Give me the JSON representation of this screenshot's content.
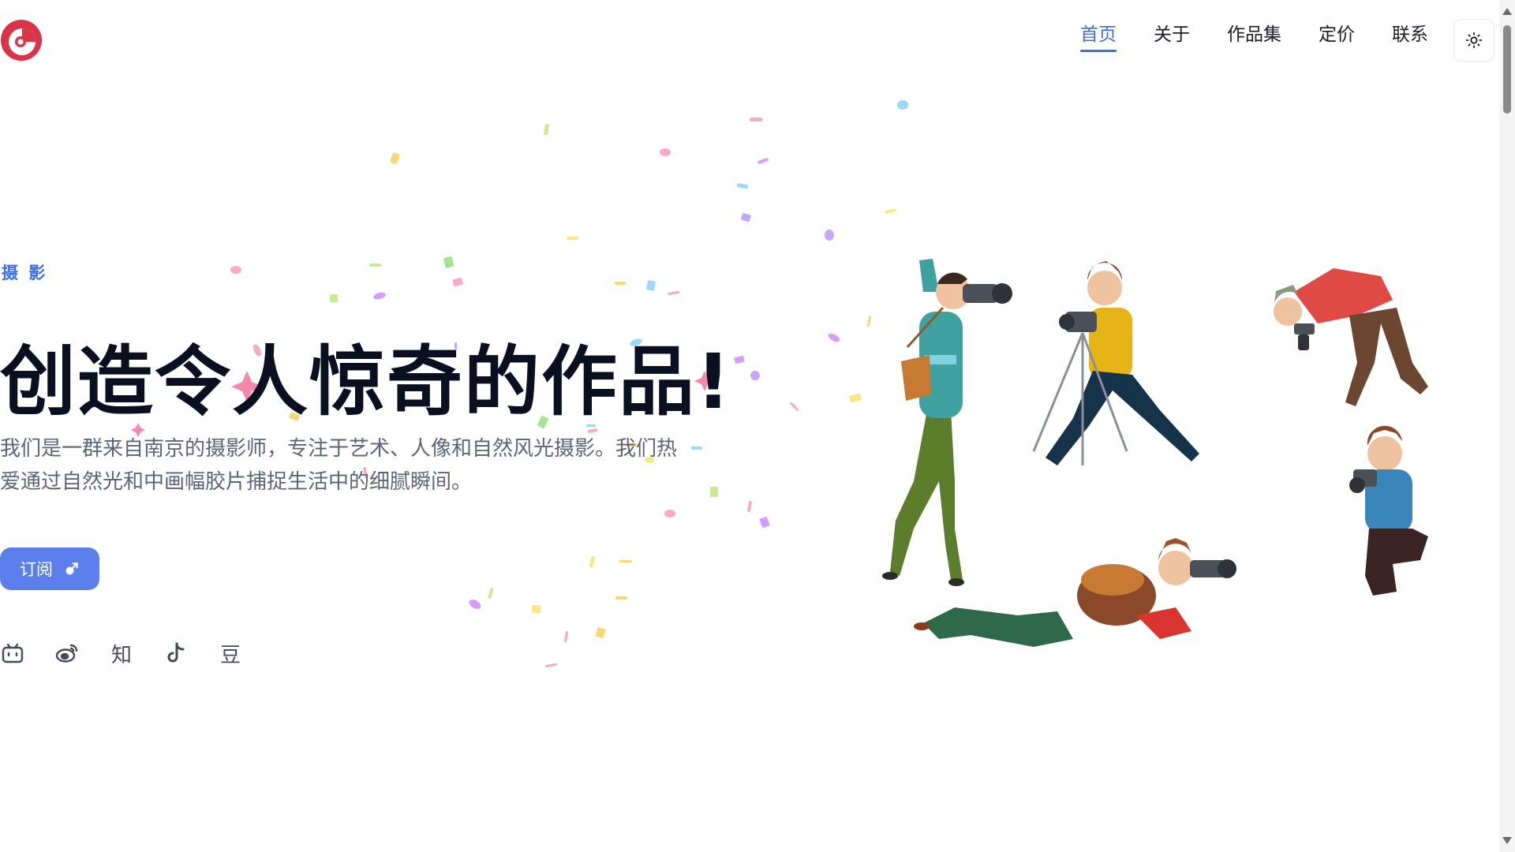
{
  "nav": {
    "items": [
      {
        "label": "首页",
        "active": true
      },
      {
        "label": "关于",
        "active": false
      },
      {
        "label": "作品集",
        "active": false
      },
      {
        "label": "定价",
        "active": false
      },
      {
        "label": "联系",
        "active": false
      }
    ],
    "theme_icon": "sun-icon"
  },
  "hero": {
    "eyebrow": "摄 影",
    "headline": "创造令人惊奇的作品!",
    "description": "我们是一群来自南京的摄影师，专注于艺术、人像和自然风光摄影。我们热爱通过自然光和中画幅胶片捕捉生活中的细腻瞬间。",
    "subscribe_label": "订阅",
    "subscribe_icon": "male-arrow-icon"
  },
  "socials": [
    {
      "name": "bilibili-icon",
      "glyph": ""
    },
    {
      "name": "weibo-icon",
      "glyph": ""
    },
    {
      "name": "zhihu-icon",
      "glyph": "知"
    },
    {
      "name": "tiktok-icon",
      "glyph": ""
    },
    {
      "name": "douban-icon",
      "glyph": "豆"
    }
  ],
  "colors": {
    "accent": "#3e6ee6",
    "button": "#5b80ee",
    "logo": "#d9344a"
  }
}
